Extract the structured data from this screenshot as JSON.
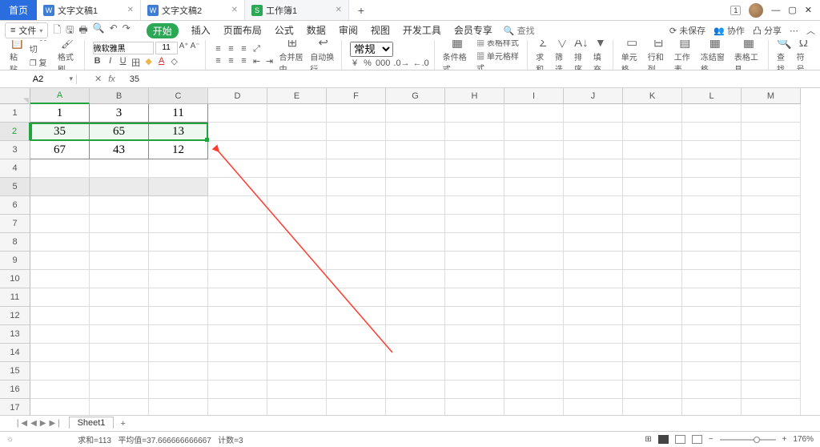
{
  "tabs": {
    "home": "首页",
    "docs": [
      {
        "icon": "w",
        "label": "文字文稿1"
      },
      {
        "icon": "w",
        "label": "文字文稿2"
      },
      {
        "icon": "s",
        "label": "工作簿1"
      }
    ],
    "badge": "1"
  },
  "file_menu": "文件",
  "ribbon_menu": [
    "开始",
    "插入",
    "页面布局",
    "公式",
    "数据",
    "审阅",
    "视图",
    "开发工具",
    "会员专享"
  ],
  "search_placeholder": "查找",
  "menu_right": {
    "unsaved": "未保存",
    "coop": "协作",
    "share": "分享"
  },
  "ribbon": {
    "clipboard": {
      "paste": "粘贴",
      "cut": "剪切",
      "copy": "复制",
      "format": "格式刷"
    },
    "font": {
      "name": "微软雅黑",
      "size": "11"
    },
    "merge": "合并居中",
    "wrap": "自动换行",
    "numfmt": "常规",
    "cond": "条件格式",
    "cellstyle": "单元格样式",
    "tblstyle": "表格样式",
    "sum": "求和",
    "filter": "筛选",
    "sort": "排序",
    "fill": "填充",
    "cell": "单元格",
    "rowcol": "行和列",
    "sheet": "工作表",
    "freeze": "冻结窗格",
    "tbltool": "表格工具",
    "find": "查找",
    "sym": "符号"
  },
  "namebox": "A2",
  "fx_value": "35",
  "columns": [
    "A",
    "B",
    "C",
    "D",
    "E",
    "F",
    "G",
    "H",
    "I",
    "J",
    "K",
    "L",
    "M"
  ],
  "rows_vis": 17,
  "cell_data": [
    [
      "1",
      "3",
      "11"
    ],
    [
      "35",
      "65",
      "13"
    ],
    [
      "67",
      "43",
      "12"
    ]
  ],
  "sheet_tab": "Sheet1",
  "status": {
    "sum_label": "求和=",
    "sum": "113",
    "avg_label": "平均值=",
    "avg": "37.666666666667",
    "cnt_label": "计数=",
    "cnt": "3"
  },
  "zoom": "176%"
}
